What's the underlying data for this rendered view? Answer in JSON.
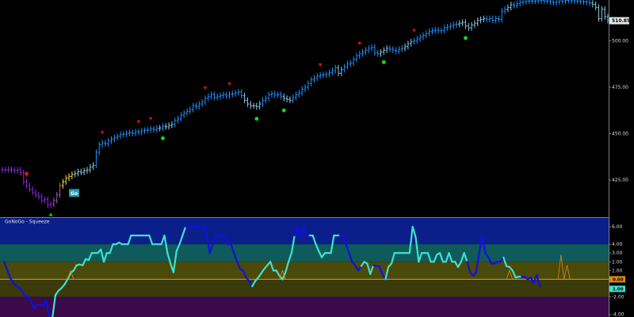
{
  "colors": {
    "background": "#000000",
    "strong_up": "#1e90ff",
    "weak_up": "#87ceeb",
    "amber": "#ffe135",
    "weak_down": "#b05ab8",
    "strong_down": "#8a2be2",
    "signal_red": "#e01010",
    "signal_green": "#10e010",
    "oscillator_line": "#40e0d0",
    "oscillator_strong": "#1010e0",
    "zero_line": "#e08a10",
    "go_badge": "#2a9ab0"
  },
  "price_panel": {
    "last_price": "510.85",
    "ylim": [
      405,
      522
    ],
    "ticks": [
      "500.00",
      "475.00",
      "450.00",
      "425.00"
    ]
  },
  "oscillator_panel": {
    "title": "GoNoGo - Squeeze",
    "ylim": [
      -4.3,
      7.0
    ],
    "ticks": [
      "6.00",
      "4.00",
      "3.00",
      "2.00",
      "1.00",
      "0.00",
      "-2.00",
      "-4.00"
    ],
    "current_value": "0.00",
    "current_badge": "1.00"
  },
  "go_label": "Go",
  "chart_data": [
    {
      "type": "ohlc",
      "title": "",
      "ylim": [
        405,
        522
      ],
      "trend_colors": [
        "#8a2be2",
        "#b05ab8",
        "#ffe135",
        "#87ceeb",
        "#1e90ff"
      ],
      "x": [
        0,
        1,
        2,
        3,
        4,
        5,
        6,
        7,
        8,
        9,
        10,
        11,
        12,
        13,
        14,
        15,
        16,
        17,
        18,
        19,
        20,
        21,
        22,
        23,
        24,
        25,
        26,
        27,
        28,
        29,
        30,
        31,
        32,
        33,
        34,
        35,
        36,
        37,
        38,
        39,
        40,
        41,
        42,
        43,
        44,
        45,
        46,
        47,
        48,
        49,
        50,
        51,
        52,
        53,
        54,
        55,
        56,
        57,
        58,
        59,
        60,
        61,
        62,
        63,
        64,
        65,
        66,
        67,
        68,
        69,
        70,
        71,
        72,
        73,
        74,
        75,
        76,
        77,
        78,
        79,
        80,
        81,
        82,
        83,
        84,
        85,
        86,
        87,
        88,
        89,
        90,
        91,
        92,
        93,
        94,
        95,
        96,
        97,
        98,
        99,
        100,
        101,
        102,
        103,
        104,
        105,
        106,
        107,
        108,
        109,
        110,
        111,
        112,
        113,
        114,
        115,
        116,
        117,
        118,
        119,
        120,
        121,
        122,
        123,
        124,
        125,
        126,
        127,
        128,
        129,
        130,
        131,
        132,
        133,
        134,
        135,
        136,
        137,
        138,
        139,
        140,
        141,
        142,
        143,
        144,
        145,
        146,
        147,
        148,
        149,
        150,
        151,
        152,
        153,
        154,
        155,
        156,
        157,
        158,
        159,
        160,
        161,
        162,
        163,
        164,
        165,
        166,
        167,
        168,
        169,
        170,
        171,
        172,
        173,
        174,
        175,
        176,
        177,
        178,
        179,
        180,
        181,
        182,
        183,
        184,
        185,
        186,
        187,
        188,
        189,
        190,
        191,
        192,
        193,
        194,
        195,
        196
      ],
      "close": [
        430.5,
        430.5,
        430.8,
        430.3,
        430,
        430.5,
        429,
        424,
        422,
        420,
        418.5,
        417,
        416,
        414,
        414.5,
        411.5,
        412,
        414,
        417,
        422,
        424,
        426,
        427,
        428,
        428.6,
        429.5,
        429.2,
        430,
        430.5,
        432,
        433,
        440,
        444,
        445,
        444.5,
        446,
        447,
        448,
        448.6,
        449.5,
        449.8,
        450.2,
        450.5,
        450.2,
        451,
        450.8,
        451.5,
        451.8,
        452,
        452.5,
        452.2,
        452.8,
        453,
        454,
        453.7,
        454.5,
        455,
        457,
        458,
        460,
        461,
        462,
        463,
        465,
        464.5,
        466,
        467,
        469,
        470,
        471,
        469.5,
        470,
        470.5,
        471,
        470.3,
        471.2,
        471.5,
        472,
        472.5,
        470.5,
        468,
        466,
        465,
        465,
        464.5,
        466,
        468,
        469,
        471,
        471.5,
        470.8,
        471,
        470,
        469,
        468.5,
        468,
        469.5,
        471,
        472,
        474,
        475,
        477,
        479,
        480,
        481,
        481.5,
        481.8,
        482,
        483,
        484,
        485.5,
        482.5,
        484.5,
        486,
        487.5,
        488,
        490,
        492,
        493,
        494,
        495,
        496,
        496.5,
        493.5,
        493,
        494,
        495,
        496,
        495.5,
        495,
        494.5,
        495.5,
        496,
        497,
        498.5,
        499.5,
        500,
        501,
        502,
        503,
        504,
        505,
        505.5,
        505.8,
        505.5,
        505.5,
        507,
        507.5,
        508,
        508.7,
        509,
        509.5,
        510,
        508,
        507,
        508.5,
        509.5,
        511,
        511.5,
        512,
        511.5,
        512,
        511,
        512,
        511.5,
        516,
        517,
        518,
        519.5,
        519,
        520,
        520.7,
        521,
        521.3,
        521.5,
        521.4,
        521.5,
        521.6,
        521.8,
        521.5,
        521.5,
        521,
        520.6,
        521,
        521.5,
        521.3,
        521.8,
        522,
        521.5,
        521.5,
        521.4,
        521.2,
        521,
        520.8,
        520.3,
        519.6,
        518,
        512,
        517,
        513,
        511
      ],
      "trend": [
        0,
        0,
        0,
        0,
        0,
        0,
        0,
        0,
        0,
        0,
        0,
        0,
        0,
        0,
        0,
        0,
        0,
        1,
        1,
        1,
        2,
        2,
        2,
        2,
        3,
        3,
        3,
        3,
        3,
        3,
        3,
        4,
        4,
        4,
        4,
        4,
        4,
        4,
        4,
        4,
        4,
        4,
        4,
        4,
        4,
        4,
        4,
        4,
        4,
        4,
        4,
        4,
        3,
        4,
        3,
        3,
        3,
        4,
        4,
        4,
        4,
        4,
        4,
        4,
        4,
        4,
        4,
        4,
        4,
        4,
        4,
        4,
        4,
        4,
        4,
        4,
        4,
        4,
        4,
        4,
        3,
        3,
        3,
        3,
        3,
        3,
        4,
        4,
        4,
        4,
        4,
        4,
        4,
        3,
        3,
        3,
        4,
        4,
        4,
        4,
        4,
        4,
        4,
        4,
        4,
        4,
        4,
        4,
        4,
        4,
        4,
        3,
        3,
        4,
        4,
        4,
        4,
        4,
        4,
        4,
        4,
        4,
        4,
        4,
        4,
        3,
        3,
        3,
        4,
        4,
        4,
        4,
        4,
        3,
        3,
        3,
        4,
        4,
        4,
        4,
        4,
        4,
        4,
        4,
        4,
        4,
        4,
        4,
        4,
        4,
        4,
        3,
        3,
        3,
        3,
        3,
        3,
        3,
        3,
        3,
        4,
        4,
        4,
        4,
        4,
        4,
        4,
        3,
        3,
        4,
        4,
        4,
        4,
        4,
        4,
        4,
        4,
        4,
        4,
        4,
        4,
        4,
        4,
        4,
        4,
        4,
        4,
        4,
        4,
        4,
        4,
        4,
        4,
        4,
        4,
        3,
        3,
        3,
        3,
        3,
        3
      ],
      "signals": [
        {
          "x": 8,
          "type": "down",
          "color": "#e01010"
        },
        {
          "x": 16,
          "type": "up",
          "color": "#10e010"
        },
        {
          "x": 33,
          "type": "down",
          "color": "#e01010"
        },
        {
          "x": 45,
          "type": "down",
          "color": "#e01010"
        },
        {
          "x": 49,
          "type": "down",
          "color": "#e01010"
        },
        {
          "x": 53,
          "type": "up-dot",
          "color": "#10e010"
        },
        {
          "x": 67,
          "type": "down",
          "color": "#e01010"
        },
        {
          "x": 75,
          "type": "down",
          "color": "#e01010"
        },
        {
          "x": 84,
          "type": "up-dot",
          "color": "#10e010"
        },
        {
          "x": 93,
          "type": "up-dot",
          "color": "#10e010"
        },
        {
          "x": 105,
          "type": "down",
          "color": "#e01010"
        },
        {
          "x": 118,
          "type": "down",
          "color": "#e01010"
        },
        {
          "x": 126,
          "type": "up-dot",
          "color": "#10e010"
        },
        {
          "x": 136,
          "type": "down",
          "color": "#e01010"
        },
        {
          "x": 153,
          "type": "up-dot",
          "color": "#10e010"
        },
        {
          "x": 184,
          "type": "down",
          "color": "#e01010"
        }
      ]
    },
    {
      "type": "line",
      "title": "GoNoGo - Squeeze",
      "ylim": [
        -4.3,
        7.0
      ],
      "x": [
        0,
        1,
        2,
        3,
        4,
        5,
        6,
        7,
        8,
        9,
        10,
        11,
        12,
        13,
        14,
        15,
        16,
        17,
        18,
        19,
        20,
        21,
        22,
        23,
        24,
        25,
        26,
        27,
        28,
        29,
        30,
        31,
        32,
        33,
        34,
        35,
        36,
        37,
        38,
        39,
        40,
        41,
        42,
        43,
        44,
        45,
        46,
        47,
        48,
        49,
        50,
        51,
        52,
        53,
        54,
        55,
        56,
        57,
        58,
        59,
        60,
        61,
        62,
        63,
        64,
        65,
        66,
        67,
        68,
        69,
        70,
        71,
        72,
        73,
        74,
        75,
        76,
        77,
        78,
        79,
        80,
        81,
        82,
        83,
        84,
        85,
        86,
        87,
        88,
        89,
        90,
        91,
        92,
        93,
        94,
        95,
        96,
        97,
        98,
        99,
        100,
        101,
        102,
        103,
        104,
        105,
        106,
        107,
        108,
        109,
        110,
        111,
        112,
        113,
        114,
        115,
        116,
        117,
        118,
        119,
        120,
        121,
        122,
        123,
        124,
        125,
        126,
        127,
        128,
        129,
        130,
        131,
        132,
        133,
        134,
        135,
        136,
        137,
        138,
        139,
        140,
        141,
        142,
        143,
        144,
        145,
        146,
        147,
        148,
        149,
        150,
        151,
        152,
        153,
        154,
        155,
        156,
        157,
        158,
        159,
        160,
        161,
        162,
        163,
        164,
        165,
        166,
        167,
        168,
        169,
        170,
        171,
        172,
        173,
        174,
        175,
        176,
        177,
        178,
        179,
        180,
        181,
        182,
        183,
        184,
        185,
        186,
        187,
        188,
        189,
        190,
        191,
        192,
        193,
        194,
        195
      ],
      "values": [
        2.0,
        1.2,
        0.2,
        -0.4,
        -0.7,
        -1.0,
        -1.3,
        -2.0,
        -1.9,
        -2.6,
        -3.3,
        -2.9,
        -2.9,
        -3.0,
        -2.4,
        -4.4,
        -4.4,
        -1.8,
        -1.3,
        -1.0,
        -0.6,
        0.0,
        0.7,
        1.0,
        1.6,
        1.7,
        1.6,
        2.3,
        2.2,
        3.0,
        3.0,
        3.0,
        3.4,
        2.0,
        3.0,
        3.0,
        4.0,
        4.0,
        4.2,
        4.0,
        4.0,
        4.0,
        5.0,
        5.0,
        5.0,
        5.0,
        5.0,
        5.0,
        5.0,
        4.0,
        4.0,
        4.0,
        4.0,
        5.0,
        3.0,
        1.8,
        0.8,
        3.2,
        4.0,
        5.0,
        6.0,
        6.0,
        6.0,
        6.0,
        6.0,
        6.0,
        6.0,
        5.0,
        3.0,
        4.0,
        5.0,
        5.0,
        5.0,
        5.0,
        4.0,
        4.0,
        3.0,
        2.0,
        1.2,
        1.0,
        0.2,
        -0.2,
        -0.8,
        -0.2,
        0.2,
        0.7,
        1.2,
        1.6,
        2.0,
        1.0,
        1.0,
        0.4,
        0.0,
        0.8,
        2.0,
        3.0,
        5.0,
        6.0,
        4.8,
        6.0,
        5.0,
        5.0,
        5.0,
        4.0,
        3.2,
        2.5,
        3.0,
        3.0,
        3.0,
        5.0,
        5.0,
        5.0,
        5.0,
        4.0,
        3.0,
        2.0,
        1.6,
        1.0,
        1.5,
        2.0,
        1.8,
        0.6,
        1.6,
        1.5,
        1.5,
        0.6,
        0.0,
        1.4,
        1.8,
        3.0,
        3.0,
        3.0,
        3.0,
        3.0,
        3.0,
        6.0,
        4.8,
        2.0,
        3.0,
        3.0,
        3.0,
        2.0,
        2.0,
        2.8,
        3.0,
        2.0,
        2.0,
        3.0,
        2.0,
        2.0,
        1.4,
        2.0,
        3.0,
        2.0,
        0.8,
        0.4,
        0.8,
        3.0,
        5.0,
        3.0,
        2.5,
        1.8,
        1.8,
        2.0,
        2.0,
        2.5,
        1.5,
        1.4,
        1.0,
        0.2,
        0.3,
        0.3,
        0.3,
        0.0,
        0.2,
        -0.4,
        0.5,
        -0.8
      ],
      "strong": [
        false,
        true,
        true,
        true,
        true,
        true,
        true,
        true,
        true,
        true,
        true,
        true,
        true,
        true,
        true,
        true,
        true,
        false,
        false,
        false,
        false,
        false,
        false,
        false,
        false,
        false,
        false,
        false,
        false,
        false,
        false,
        false,
        false,
        false,
        false,
        false,
        false,
        false,
        false,
        false,
        false,
        false,
        false,
        false,
        false,
        false,
        false,
        false,
        false,
        false,
        false,
        false,
        false,
        false,
        false,
        false,
        false,
        false,
        false,
        false,
        false,
        true,
        true,
        true,
        true,
        true,
        true,
        true,
        true,
        true,
        true,
        true,
        true,
        true,
        true,
        true,
        true,
        true,
        true,
        true,
        true,
        true,
        true,
        false,
        false,
        false,
        false,
        false,
        false,
        false,
        false,
        false,
        false,
        false,
        false,
        false,
        false,
        true,
        true,
        true,
        true,
        true,
        false,
        false,
        false,
        false,
        false,
        false,
        false,
        false,
        false,
        false,
        true,
        true,
        true,
        true,
        true,
        true,
        true,
        false,
        false,
        false,
        false,
        true,
        true,
        true,
        true,
        false,
        false,
        false,
        false,
        false,
        false,
        false,
        false,
        false,
        false,
        false,
        false,
        false,
        false,
        false,
        false,
        false,
        false,
        false,
        false,
        false,
        false,
        false,
        false,
        false,
        false,
        false,
        true,
        true,
        true,
        true,
        true,
        true,
        true,
        true,
        true,
        true,
        true,
        true,
        false,
        false,
        false,
        false,
        false,
        false,
        true,
        true,
        true,
        true,
        true,
        true,
        true,
        false,
        false,
        false,
        false,
        false
      ],
      "reference_lines": [
        0,
        1
      ],
      "bands": [
        {
          "from": 4,
          "to": 7,
          "color": "#0a1f8a"
        },
        {
          "from": 2,
          "to": 4,
          "color": "#0f5a5a"
        },
        {
          "from": 0,
          "to": 2,
          "color": "#4a4a0a"
        },
        {
          "from": -2,
          "to": 0,
          "color": "#3a3a0a"
        },
        {
          "from": -4.3,
          "to": -2,
          "color": "#3a0a4a"
        }
      ]
    }
  ]
}
